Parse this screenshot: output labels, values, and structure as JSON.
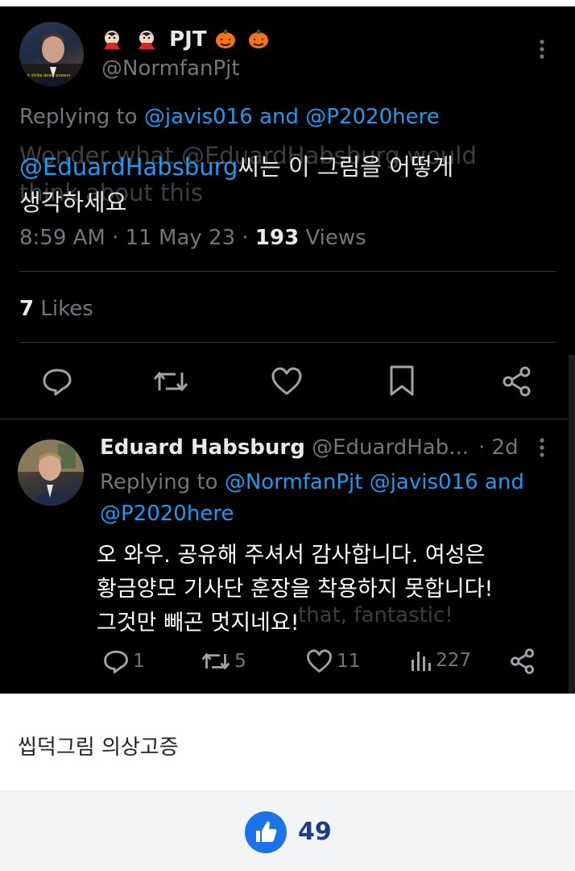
{
  "tweet1": {
    "display_name": "PJT",
    "handle": "@NormfanPjt",
    "replying_label": "Replying to",
    "reply_to_1": "@javis016",
    "and": "and",
    "reply_to_2": "@P2020here",
    "mention": "@EduardHabsburg",
    "text_line1_rest": "씨는 이 그림을 어떻게",
    "text_line2": "생각하세요",
    "ghost_line1": "Wonder what @EduardHabsburg would",
    "ghost_line2": "think about this",
    "time": "8:59 AM · 11 May 23 · ",
    "views_count": "193",
    "views_label": " Views",
    "likes_count": "7",
    "likes_label": " Likes"
  },
  "tweet2": {
    "display_name": "Eduard Habsburg",
    "handle": "@EduardHab...",
    "age": "· 2d",
    "replying_label": "Replying to",
    "reply_to_1": "@NormfanPjt",
    "reply_to_2": "@javis016",
    "and": "and",
    "reply_to_3": "@P2020here",
    "text_line1": "오 와우. 공유해 주셔서 감사합니다. 여성은",
    "text_line2": "황금양모 기사단 훈장을 착용하지 못합니다!",
    "text_line3": "그것만 빼곤 멋지네요!",
    "ghost_line3": "that, fantastic!",
    "replies": "1",
    "retweets": "5",
    "likes": "11",
    "views": "227"
  },
  "caption": "씹덕그림 의상고증",
  "like_count": "49",
  "colors": {
    "accent": "#1d9bf0",
    "like_button": "#1a73e8",
    "like_count": "#1e3a8a"
  },
  "icons": [
    "more-icon",
    "reply-icon",
    "retweet-icon",
    "like-icon",
    "bookmark-icon",
    "share-icon",
    "views-icon",
    "thumbs-up-icon"
  ]
}
